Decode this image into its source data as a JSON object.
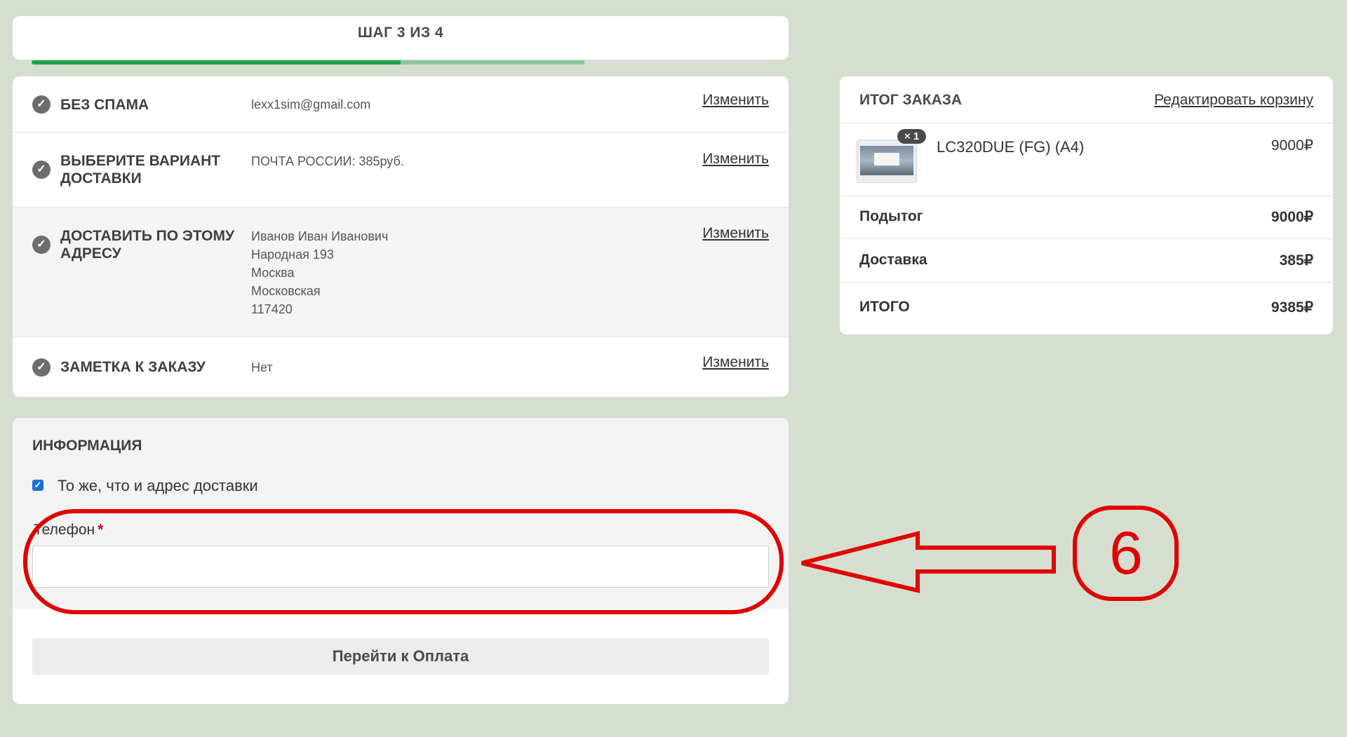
{
  "progress": {
    "title": "ШАГ 3 ИЗ 4",
    "completed_fraction": 0.5,
    "current_fraction": 0.75
  },
  "steps": [
    {
      "title": "БЕЗ СПАМА",
      "value_lines": [
        "lexx1sim@gmail.com"
      ],
      "edit_label": "Изменить"
    },
    {
      "title": "ВЫБЕРИТЕ ВАРИАНТ ДОСТАВКИ",
      "value_lines": [
        "ПОЧТА РОССИИ: 385руб."
      ],
      "edit_label": "Изменить"
    },
    {
      "title": "ДОСТАВИТЬ ПО ЭТОМУ АДРЕСУ",
      "value_lines": [
        "Иванов Иван Иванович",
        "Народная 193",
        "Москва",
        "Московская",
        "117420"
      ],
      "edit_label": "Изменить"
    },
    {
      "title": "ЗАМЕТКА К ЗАКАЗУ",
      "value_lines": [
        "Нет"
      ],
      "edit_label": "Изменить"
    }
  ],
  "info": {
    "title": "ИНФОРМАЦИЯ",
    "same_as_shipping_label": "То же, что и адрес доставки",
    "same_as_shipping_checked": true,
    "phone_label": "Телефон",
    "phone_required_mark": "*",
    "phone_value": "",
    "next_button_label": "Перейти к Оплата"
  },
  "summary": {
    "title": "ИТОГ ЗАКАЗА",
    "edit_cart_label": "Редактировать корзину",
    "items": [
      {
        "name": "LC320DUE (FG) (A4)",
        "qty_badge": "× 1",
        "price": "9000₽"
      }
    ],
    "subtotal_label": "Подытог",
    "subtotal_value": "9000₽",
    "shipping_label": "Доставка",
    "shipping_value": "385₽",
    "total_label": "ИТОГО",
    "total_value": "9385₽"
  },
  "annotation": {
    "number": "6",
    "color": "#e00000"
  },
  "colors": {
    "background": "#d6dfcf",
    "progress_done": "#1ea34a",
    "progress_current": "#8fc7a1",
    "checkbox": "#1a6fdb"
  }
}
